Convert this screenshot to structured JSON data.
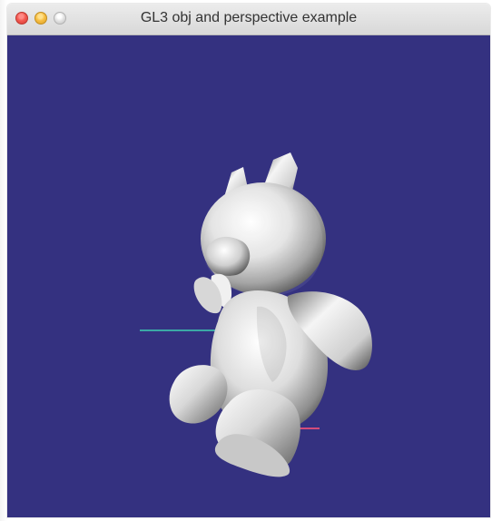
{
  "window": {
    "title": "GL3 obj and perspective example"
  },
  "traffic_lights": [
    {
      "name": "close",
      "color": "#f35a51"
    },
    {
      "name": "minimize",
      "color": "#f7be43"
    },
    {
      "name": "zoom",
      "color": "#d7d7d7"
    }
  ],
  "viewport": {
    "background_color": "#343180",
    "axes_colors": {
      "x_axis": "#d34c7a",
      "z_axis": "#3ba8a6"
    },
    "model": {
      "description_icon": "teddy-bear-3d-model",
      "material_color": "#d8d8d8"
    }
  }
}
